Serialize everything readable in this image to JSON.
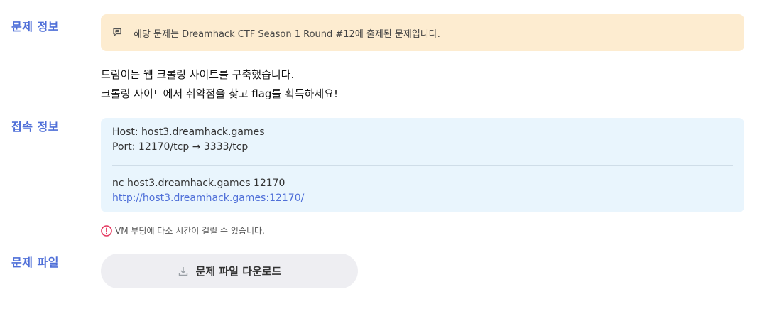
{
  "sections": {
    "problem_info": "문제 정보",
    "access_info": "접속 정보",
    "problem_file": "문제 파일"
  },
  "notice": {
    "text": "해당 문제는 Dreamhack CTF Season 1 Round #12에 출제된 문제입니다.",
    "icon": "message-flag-icon"
  },
  "description": [
    "드림이는 웹 크롤링 사이트를 구축했습니다.",
    "크롤링 사이트에서 취약점을 찾고 flag를 획득하세요!"
  ],
  "connection": {
    "host": "Host: host3.dreamhack.games",
    "port": "Port: 12170/tcp → 3333/tcp",
    "nc": "nc host3.dreamhack.games 12170",
    "url": "http://host3.dreamhack.games:12170/"
  },
  "warning": {
    "text": "VM 부팅에 다소 시간이 걸릴 수 있습니다.",
    "icon": "exclamation-circle-icon",
    "color": "#e5365e"
  },
  "download": {
    "label": "문제 파일 다운로드",
    "icon": "download-icon"
  }
}
